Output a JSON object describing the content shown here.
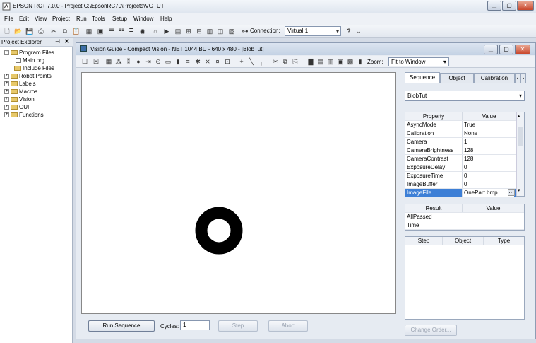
{
  "app": {
    "title": "EPSON RC+ 7.0.0 - Project C:\\EpsonRC70\\Projects\\VGTUT"
  },
  "menu": [
    "File",
    "Edit",
    "View",
    "Project",
    "Run",
    "Tools",
    "Setup",
    "Window",
    "Help"
  ],
  "toolbar": {
    "connection_label": "Connection:",
    "connection_value": "Virtual 1"
  },
  "explorer": {
    "title": "Project Explorer",
    "items": [
      {
        "label": "Program Files",
        "level": 0,
        "type": "folder-open"
      },
      {
        "label": "Main.prg",
        "level": 1,
        "type": "file"
      },
      {
        "label": "Include Files",
        "level": 1,
        "type": "folder"
      },
      {
        "label": "Robot Points",
        "level": 0,
        "type": "folder"
      },
      {
        "label": "Labels",
        "level": 0,
        "type": "folder"
      },
      {
        "label": "Macros",
        "level": 0,
        "type": "folder"
      },
      {
        "label": "Vision",
        "level": 0,
        "type": "folder"
      },
      {
        "label": "GUI",
        "level": 0,
        "type": "folder"
      },
      {
        "label": "Functions",
        "level": 0,
        "type": "folder"
      }
    ]
  },
  "vision": {
    "title": "Vision Guide - Compact Vision - NET 1044 BU - 640 x 480 - [BlobTut]",
    "zoom_label": "Zoom:",
    "zoom_value": "Fit to Window",
    "run_button": "Run Sequence",
    "cycles_label": "Cycles:",
    "cycles_value": "1",
    "step_button": "Step",
    "abort_button": "Abort"
  },
  "panel": {
    "tabs": [
      "Sequence",
      "Object",
      "Calibration"
    ],
    "sequence_value": "BlobTut",
    "prop_headers": [
      "Property",
      "Value"
    ],
    "properties": [
      {
        "name": "AsyncMode",
        "value": "True"
      },
      {
        "name": "Calibration",
        "value": "None"
      },
      {
        "name": "Camera",
        "value": "1"
      },
      {
        "name": "CameraBrightness",
        "value": "128"
      },
      {
        "name": "CameraContrast",
        "value": "128"
      },
      {
        "name": "ExposureDelay",
        "value": "0"
      },
      {
        "name": "ExposureTime",
        "value": "0"
      },
      {
        "name": "ImageBuffer",
        "value": "0"
      },
      {
        "name": "ImageFile",
        "value": "OnePart.bmp"
      }
    ],
    "result_headers": [
      "Result",
      "Value"
    ],
    "results": [
      {
        "name": "AllPassed",
        "value": ""
      },
      {
        "name": "Time",
        "value": ""
      }
    ],
    "step_headers": [
      "Step",
      "Object",
      "Type"
    ],
    "change_order_button": "Change Order..."
  }
}
